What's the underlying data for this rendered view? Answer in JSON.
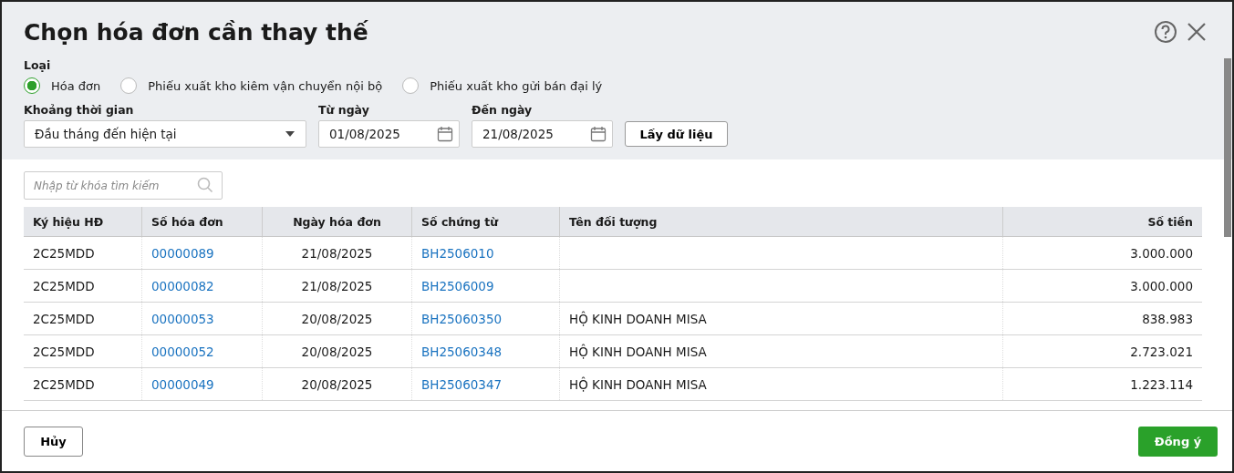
{
  "dialog": {
    "title": "Chọn hóa đơn cần thay thế"
  },
  "type_group": {
    "label": "Loại",
    "options": [
      {
        "label": "Hóa đơn",
        "selected": true
      },
      {
        "label": "Phiếu xuất kho kiêm vận chuyển nội bộ",
        "selected": false
      },
      {
        "label": "Phiếu xuất kho gửi bán đại lý",
        "selected": false
      }
    ]
  },
  "period": {
    "label": "Khoảng thời gian",
    "value": "Đầu tháng đến hiện tại"
  },
  "from_date": {
    "label": "Từ ngày",
    "value": "01/08/2025"
  },
  "to_date": {
    "label": "Đến ngày",
    "value": "21/08/2025"
  },
  "fetch_button": "Lấy dữ liệu",
  "search": {
    "placeholder": "Nhập từ khóa tìm kiếm"
  },
  "table": {
    "columns": [
      {
        "label": "Ký hiệu HĐ",
        "kind": "text"
      },
      {
        "label": "Số hóa đơn",
        "kind": "link"
      },
      {
        "label": "Ngày hóa đơn",
        "kind": "date"
      },
      {
        "label": "Số chứng từ",
        "kind": "link"
      },
      {
        "label": "Tên đối tượng",
        "kind": "text"
      },
      {
        "label": "Số tiền",
        "kind": "amount"
      }
    ],
    "rows": [
      [
        "2C25MDD",
        "00000089",
        "21/08/2025",
        "BH2506010",
        "",
        "3.000.000"
      ],
      [
        "2C25MDD",
        "00000082",
        "21/08/2025",
        "BH2506009",
        "",
        "3.000.000"
      ],
      [
        "2C25MDD",
        "00000053",
        "20/08/2025",
        "BH25060350",
        "HỘ KINH DOANH MISA",
        "838.983"
      ],
      [
        "2C25MDD",
        "00000052",
        "20/08/2025",
        "BH25060348",
        "HỘ KINH DOANH MISA",
        "2.723.021"
      ],
      [
        "2C25MDD",
        "00000049",
        "20/08/2025",
        "BH25060347",
        "HỘ KINH DOANH MISA",
        "1.223.114"
      ]
    ]
  },
  "footer": {
    "cancel": "Hủy",
    "confirm": "Đồng ý"
  }
}
